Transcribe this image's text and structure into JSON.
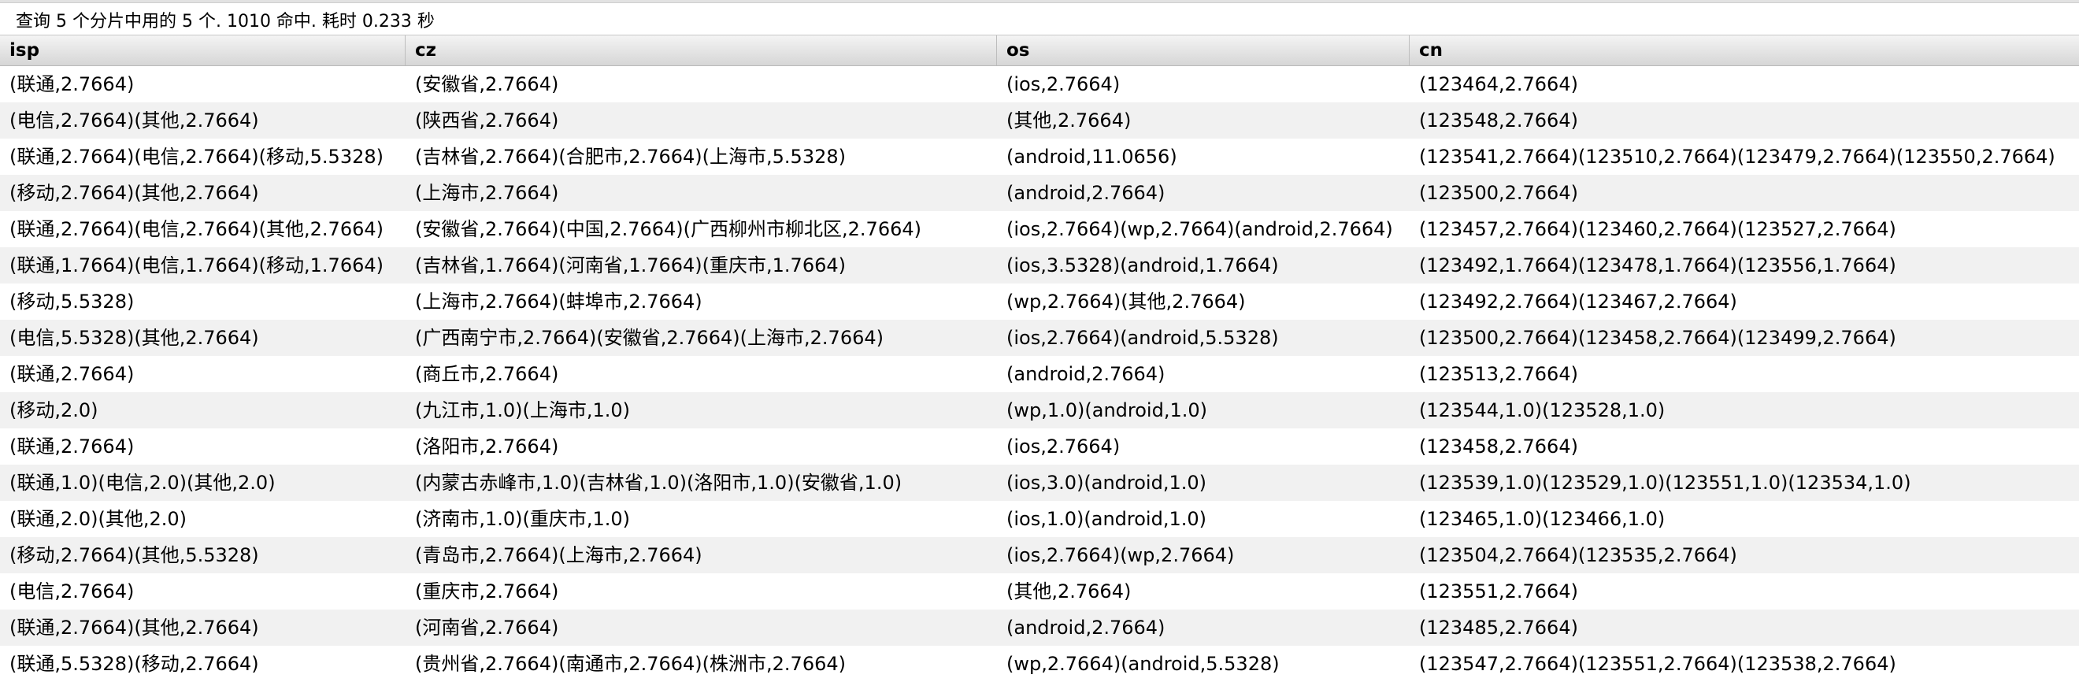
{
  "status_text": "查询 5 个分片中用的 5 个. 1010 命中. 耗时 0.233 秒",
  "columns": [
    "isp",
    "cz",
    "os",
    "cn"
  ],
  "rows": [
    [
      "(联通,2.7664)",
      "(安徽省,2.7664)",
      "(ios,2.7664)",
      "(123464,2.7664)"
    ],
    [
      "(电信,2.7664)(其他,2.7664)",
      "(陕西省,2.7664)",
      "(其他,2.7664)",
      "(123548,2.7664)"
    ],
    [
      "(联通,2.7664)(电信,2.7664)(移动,5.5328)",
      "(吉林省,2.7664)(合肥市,2.7664)(上海市,5.5328)",
      "(android,11.0656)",
      "(123541,2.7664)(123510,2.7664)(123479,2.7664)(123550,2.7664)"
    ],
    [
      "(移动,2.7664)(其他,2.7664)",
      "(上海市,2.7664)",
      "(android,2.7664)",
      "(123500,2.7664)"
    ],
    [
      "(联通,2.7664)(电信,2.7664)(其他,2.7664)",
      "(安徽省,2.7664)(中国,2.7664)(广西柳州市柳北区,2.7664)",
      "(ios,2.7664)(wp,2.7664)(android,2.7664)",
      "(123457,2.7664)(123460,2.7664)(123527,2.7664)"
    ],
    [
      "(联通,1.7664)(电信,1.7664)(移动,1.7664)",
      "(吉林省,1.7664)(河南省,1.7664)(重庆市,1.7664)",
      "(ios,3.5328)(android,1.7664)",
      "(123492,1.7664)(123478,1.7664)(123556,1.7664)"
    ],
    [
      "(移动,5.5328)",
      "(上海市,2.7664)(蚌埠市,2.7664)",
      "(wp,2.7664)(其他,2.7664)",
      "(123492,2.7664)(123467,2.7664)"
    ],
    [
      "(电信,5.5328)(其他,2.7664)",
      "(广西南宁市,2.7664)(安徽省,2.7664)(上海市,2.7664)",
      "(ios,2.7664)(android,5.5328)",
      "(123500,2.7664)(123458,2.7664)(123499,2.7664)"
    ],
    [
      "(联通,2.7664)",
      "(商丘市,2.7664)",
      "(android,2.7664)",
      "(123513,2.7664)"
    ],
    [
      "(移动,2.0)",
      "(九江市,1.0)(上海市,1.0)",
      "(wp,1.0)(android,1.0)",
      "(123544,1.0)(123528,1.0)"
    ],
    [
      "(联通,2.7664)",
      "(洛阳市,2.7664)",
      "(ios,2.7664)",
      "(123458,2.7664)"
    ],
    [
      "(联通,1.0)(电信,2.0)(其他,2.0)",
      "(内蒙古赤峰市,1.0)(吉林省,1.0)(洛阳市,1.0)(安徽省,1.0)",
      "(ios,3.0)(android,1.0)",
      "(123539,1.0)(123529,1.0)(123551,1.0)(123534,1.0)"
    ],
    [
      "(联通,2.0)(其他,2.0)",
      "(济南市,1.0)(重庆市,1.0)",
      "(ios,1.0)(android,1.0)",
      "(123465,1.0)(123466,1.0)"
    ],
    [
      "(移动,2.7664)(其他,5.5328)",
      "(青岛市,2.7664)(上海市,2.7664)",
      "(ios,2.7664)(wp,2.7664)",
      "(123504,2.7664)(123535,2.7664)"
    ],
    [
      "(电信,2.7664)",
      "(重庆市,2.7664)",
      "(其他,2.7664)",
      "(123551,2.7664)"
    ],
    [
      "(联通,2.7664)(其他,2.7664)",
      "(河南省,2.7664)",
      "(android,2.7664)",
      "(123485,2.7664)"
    ],
    [
      "(联通,5.5328)(移动,2.7664)",
      "(贵州省,2.7664)(南通市,2.7664)(株洲市,2.7664)",
      "(wp,2.7664)(android,5.5328)",
      "(123547,2.7664)(123551,2.7664)(123538,2.7664)"
    ]
  ]
}
